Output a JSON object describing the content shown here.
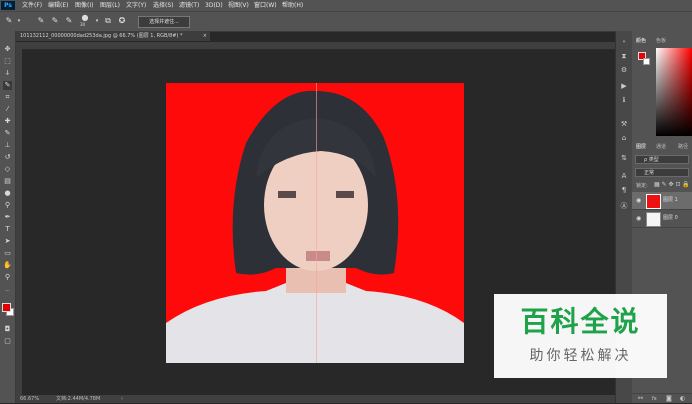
{
  "app": {
    "logo": "Ps"
  },
  "menu": [
    "文件(F)",
    "编辑(E)",
    "图像(I)",
    "图层(L)",
    "文字(Y)",
    "选择(S)",
    "滤镜(T)",
    "3D(D)",
    "视图(V)",
    "窗口(W)",
    "帮助(H)"
  ],
  "options": {
    "brush_size": "30",
    "select_subject_label": "选择并遮住..."
  },
  "document": {
    "tab_title": "101132112_00000000dad253da.jpg @ 66.7% (图层 1, RGB/8#) *",
    "tab_close": "×"
  },
  "status": {
    "zoom": "66.67%",
    "doc_info": "文档:2.44M/4.78M"
  },
  "panels": {
    "color_tab": "颜色",
    "swatch_tab": "色板",
    "layers_tab": "图层",
    "channels_tab": "通道",
    "paths_tab": "路径",
    "kind_label": "ρ 类型",
    "blend_mode": "正常",
    "lock_label": "锁定:",
    "layers": [
      {
        "name": "图层 1"
      },
      {
        "name": "图层 0"
      }
    ]
  },
  "watermark": {
    "title": "百科全说",
    "subtitle": "助你轻松解决"
  },
  "colors": {
    "canvas_bg": "#ff0a0a",
    "foreground": "#e00000",
    "watermark_green": "#20a24a"
  }
}
